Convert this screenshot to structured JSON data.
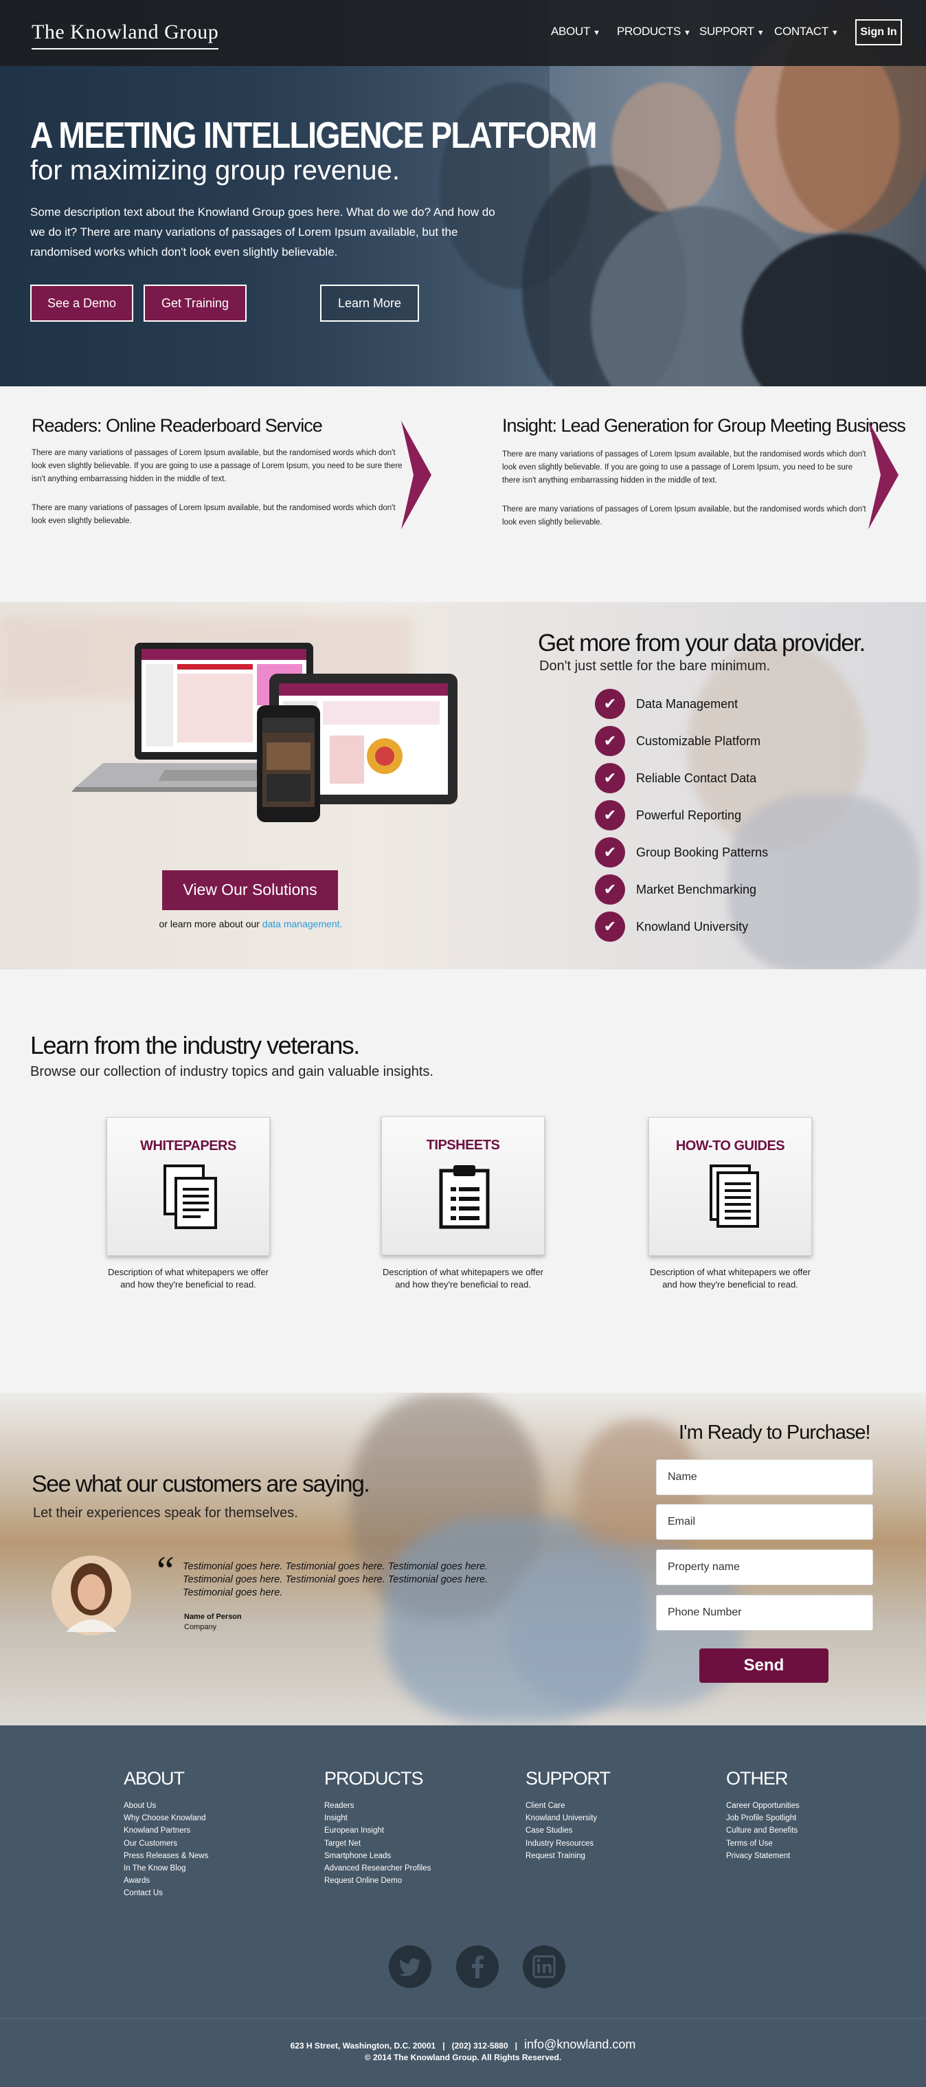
{
  "brand": {
    "logo": "The Knowland Group",
    "accent": "#7a1a4a",
    "footer_bg": "#465767"
  },
  "nav": {
    "items": [
      {
        "label": "ABOUT"
      },
      {
        "label": "PRODUCTS"
      },
      {
        "label": "SUPPORT"
      },
      {
        "label": "CONTACT"
      }
    ],
    "signin": "Sign In"
  },
  "hero": {
    "title": "A MEETING INTELLIGENCE PLATFORM",
    "subtitle": "for maximizing group revenue.",
    "description": "Some description text about the Knowland Group goes here. What do we do? And how do we do it? There are many variations of passages of Lorem Ipsum available, but the randomised works which don't look even slightly believable.",
    "buttons": {
      "demo": "See a Demo",
      "training": "Get Training",
      "learn": "Learn More"
    }
  },
  "products": [
    {
      "title": "Readers: Online Readerboard Service",
      "p1": "There are many variations of passages of Lorem Ipsum available, but the randomised words which don't look even slightly believable. If you are going to use a passage of Lorem Ipsum, you need to be sure there isn't anything embarrassing hidden in the middle of text.",
      "p2": "There are many variations of passages of Lorem Ipsum available, but the randomised words which don't look even slightly believable."
    },
    {
      "title": "Insight: Lead Generation for Group Meeting Business",
      "p1": "There are many variations of passages of Lorem Ipsum available, but the randomised words which don't look even slightly believable. If you are going to use a passage of Lorem Ipsum, you need to be sure there isn't anything embarrassing hidden in the middle of text.",
      "p2": "There are many variations of passages of Lorem Ipsum available, but the randomised words which don't look even slightly believable."
    }
  ],
  "data_section": {
    "title": "Get more from your data provider.",
    "subtitle": "Don't just settle for the bare minimum.",
    "features": [
      "Data Management",
      "Customizable Platform",
      "Reliable Contact Data",
      "Powerful Reporting",
      "Group Booking Patterns",
      "Market Benchmarking",
      "Knowland University"
    ],
    "cta": "View Our Solutions",
    "learn_prefix": "or learn more about our",
    "learn_link": "data management."
  },
  "learn": {
    "title": "Learn from the industry veterans.",
    "subtitle": "Browse our collection of industry topics and gain valuable insights.",
    "cards": [
      {
        "title": "WHITEPAPERS",
        "icon": "documents-icon",
        "desc": "Description of what whitepapers we offer and how they're beneficial to read."
      },
      {
        "title": "TIPSHEETS",
        "icon": "clipboard-icon",
        "desc": "Description of what whitepapers we offer and how they're beneficial to read."
      },
      {
        "title": "HOW-TO GUIDES",
        "icon": "guide-icon",
        "desc": "Description of what whitepapers we offer and how they're beneficial to read."
      }
    ]
  },
  "testimonials": {
    "title": "See what our customers are saying.",
    "subtitle": "Let their experiences speak for themselves.",
    "quote": "Testimonial goes here. Testimonial goes here. Testimonial goes here. Testimonial goes here. Testimonial goes here. Testimonial goes here. Testimonial goes here.",
    "name": "Name of Person",
    "company": "Company"
  },
  "purchase_form": {
    "title": "I'm Ready to Purchase!",
    "name_placeholder": "Name",
    "email_placeholder": "Email",
    "property_placeholder": "Property name",
    "phone_placeholder": "Phone Number",
    "submit": "Send"
  },
  "footer": {
    "columns": [
      {
        "heading": "ABOUT",
        "links": [
          "About Us",
          "Why Choose Knowland",
          "Knowland Partners",
          "Our Customers",
          "Press Releases & News",
          "In The Know Blog",
          "Awards",
          "Contact Us"
        ]
      },
      {
        "heading": "PRODUCTS",
        "links": [
          "Readers",
          "Insight",
          "European Insight",
          "Target Net",
          "Smartphone Leads",
          "Advanced Researcher Profiles",
          "Request Online Demo"
        ]
      },
      {
        "heading": "SUPPORT",
        "links": [
          "Client Care",
          "Knowland University",
          "Case Studies",
          "Industry Resources",
          "Request Training"
        ]
      },
      {
        "heading": "OTHER",
        "links": [
          "Career Opportunities",
          "Job Profile Spotlight",
          "Culture and Benefits",
          "Terms of Use",
          "Privacy Statement"
        ]
      }
    ],
    "address": "623 H Street, Washington, D.C. 20001",
    "phone": "(202) 312-5880",
    "email": "info@knowland.com",
    "copyright": "© 2014 The Knowland Group. All Rights Reserved."
  }
}
